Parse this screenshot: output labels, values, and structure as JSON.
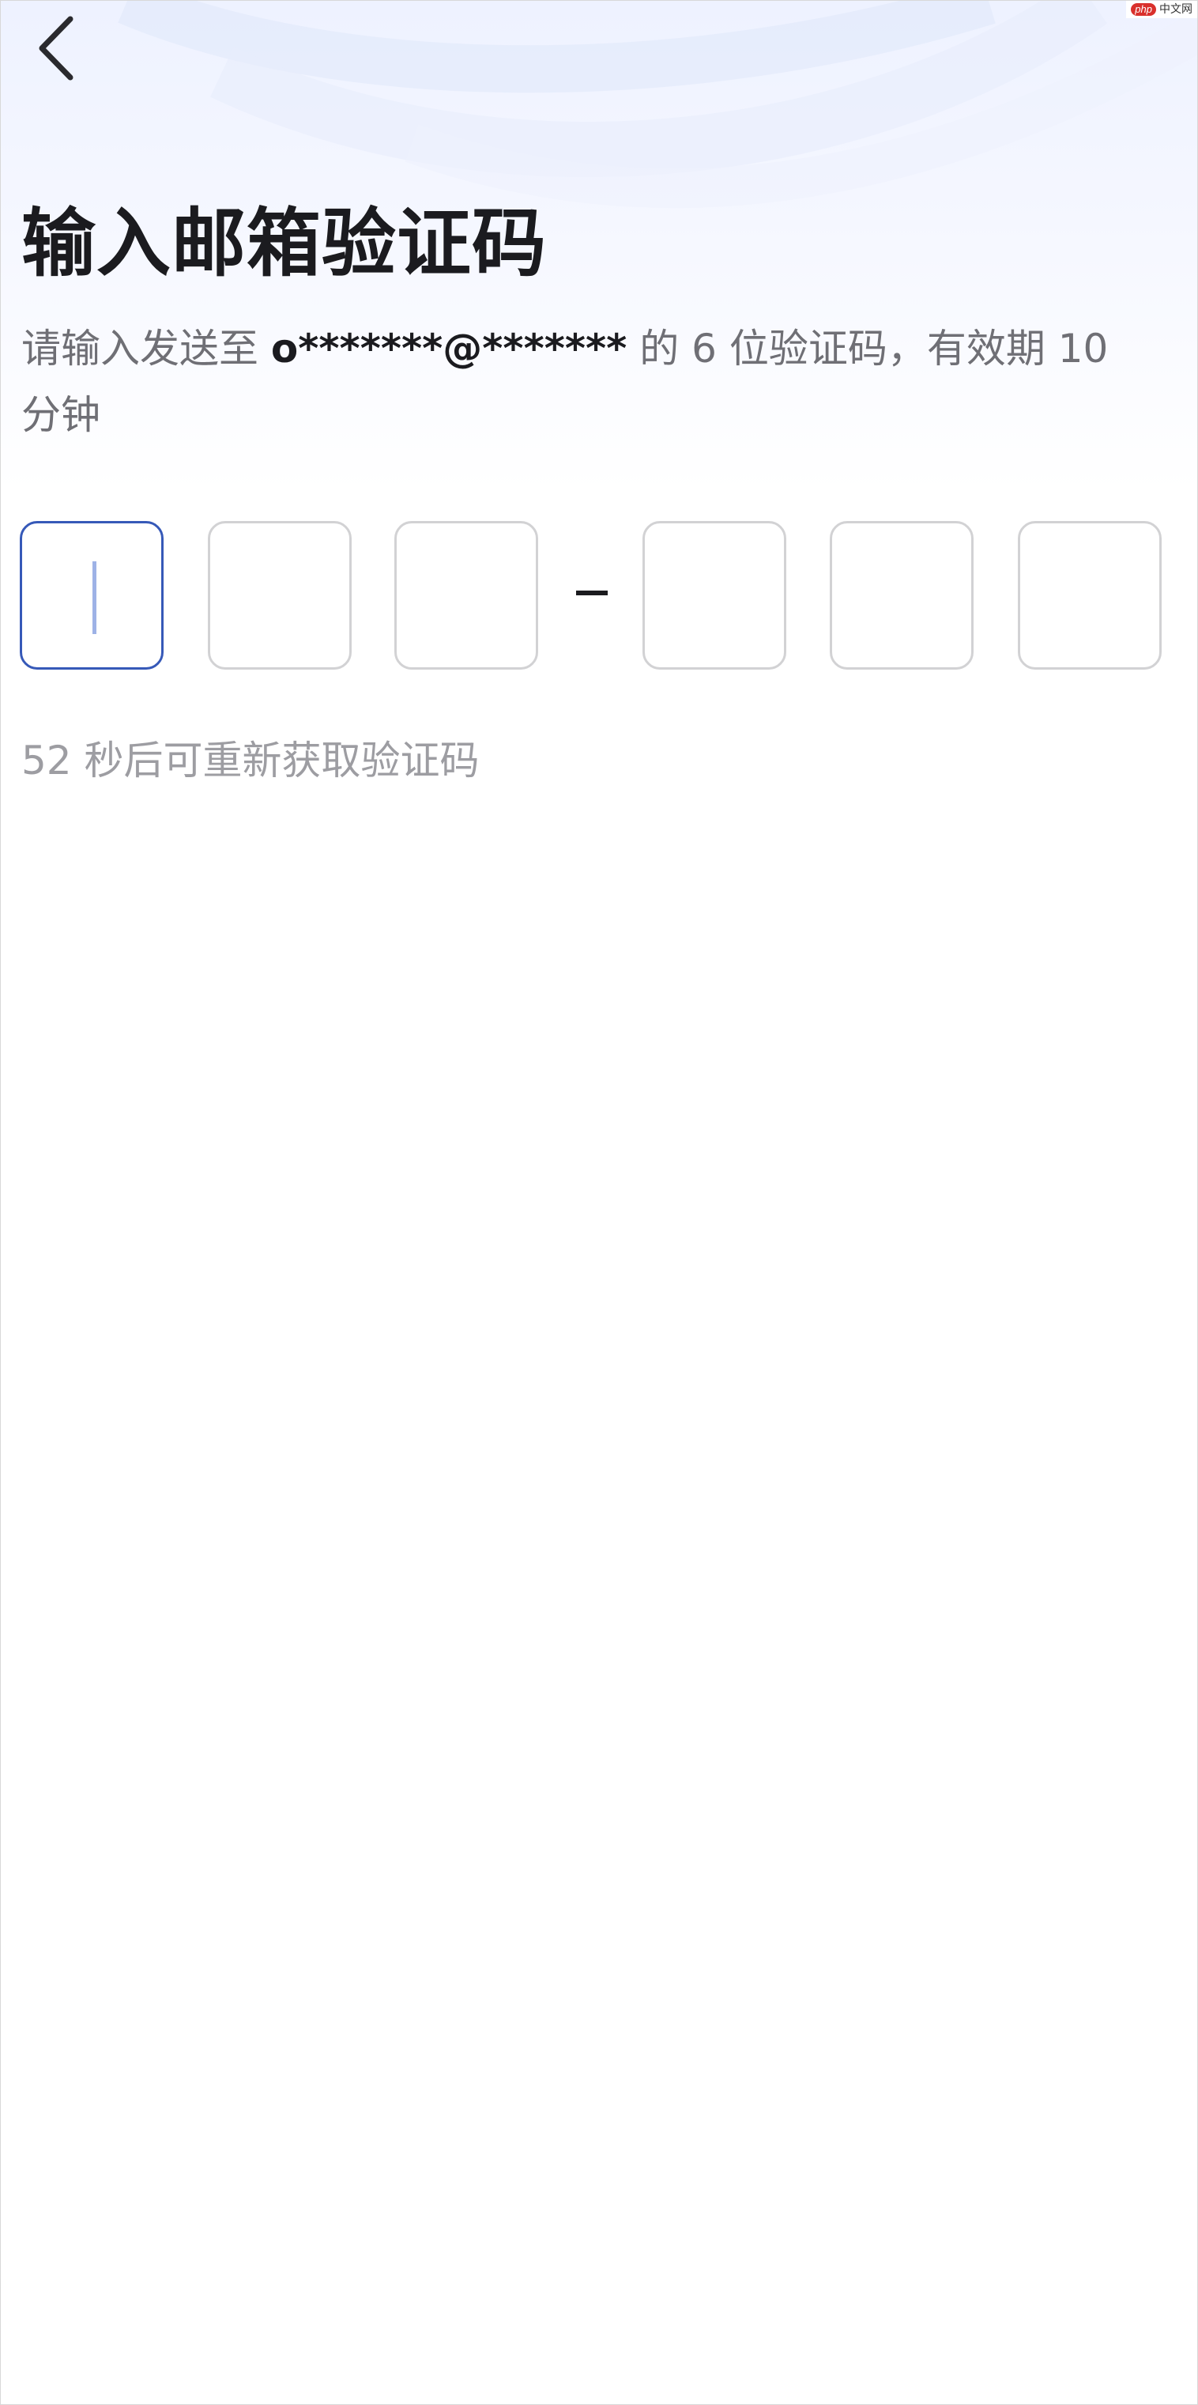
{
  "watermark": {
    "badge": "php",
    "text": "中文网"
  },
  "header": {
    "back_icon": "chevron-left-icon"
  },
  "main": {
    "title": "输入邮箱验证码",
    "subtitle_before": "请输入发送至 ",
    "masked_email": "o*******@*******",
    "subtitle_after": " 的 6 位验证码，有效期 10 分钟",
    "code_length": 6,
    "code_values": [
      "",
      "",
      "",
      "",
      "",
      ""
    ],
    "separator": "-",
    "resend_timer": "52 秒后可重新获取验证码"
  },
  "colors": {
    "title": "#1b1b1f",
    "subtitle": "#6f6f75",
    "active_border": "#3659b8",
    "inactive_border": "#d2d2d4",
    "caret": "#9eb2e6",
    "timer": "#9d9da2",
    "header_tint": "#eef2ff"
  }
}
